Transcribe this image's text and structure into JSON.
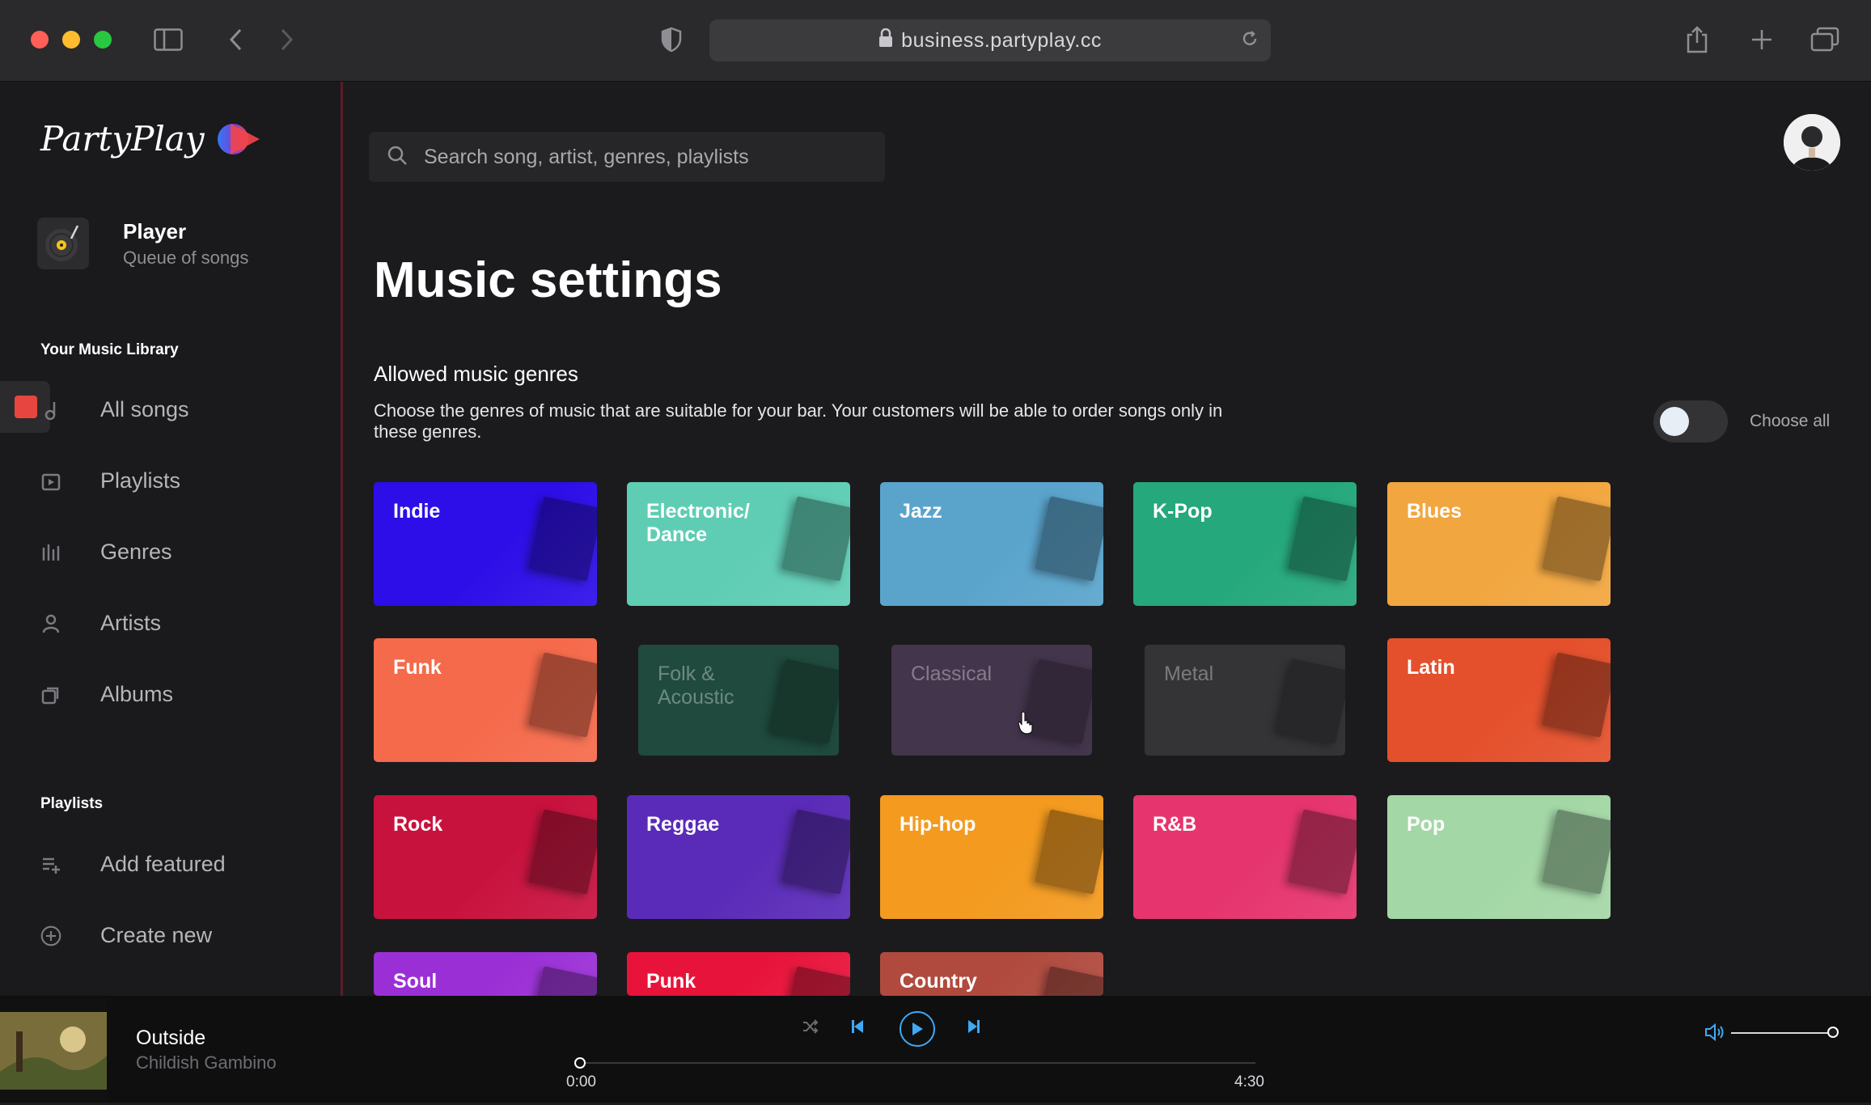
{
  "browser": {
    "url": "business.partyplay.cc"
  },
  "brand": {
    "logo_text": "PartyPlay",
    "accent": "#e6463f"
  },
  "sidebar": {
    "player": {
      "title": "Player",
      "subtitle": "Queue of songs"
    },
    "library_label": "Your Music Library",
    "library_items": [
      {
        "label": "All songs",
        "icon": "music-note-icon"
      },
      {
        "label": "Playlists",
        "icon": "playlist-icon"
      },
      {
        "label": "Genres",
        "icon": "equalizer-icon"
      },
      {
        "label": "Artists",
        "icon": "person-icon"
      },
      {
        "label": "Albums",
        "icon": "album-icon"
      }
    ],
    "playlists_label": "Playlists",
    "playlist_items": [
      {
        "label": "Add featured",
        "icon": "add-list-icon"
      },
      {
        "label": "Create new",
        "icon": "plus-circle-icon"
      }
    ]
  },
  "search": {
    "placeholder": "Search song, artist, genres, playlists"
  },
  "main": {
    "title": "Music settings",
    "section_title": "Allowed music genres",
    "description": "Choose the genres of music that are suitable for your bar. Your customers will be able to order songs only in these genres.",
    "choose_all_label": "Choose all",
    "choose_all_enabled": false
  },
  "genres": [
    {
      "label": "Indie",
      "enabled": true,
      "color": "#2d0ee8"
    },
    {
      "label": "Electronic/ Dance",
      "enabled": true,
      "color": "#5fcdb4"
    },
    {
      "label": "Jazz",
      "enabled": true,
      "color": "#5aa4cc"
    },
    {
      "label": "K-Pop",
      "enabled": true,
      "color": "#25a87c"
    },
    {
      "label": "Blues",
      "enabled": true,
      "color": "#f2a63f"
    },
    {
      "label": "Funk",
      "enabled": true,
      "color": "#f56a4b"
    },
    {
      "label": "Folk & Acoustic",
      "enabled": false,
      "color": "#1f4a3d"
    },
    {
      "label": "Classical",
      "enabled": false,
      "color": "#43354c"
    },
    {
      "label": "Metal",
      "enabled": false,
      "color": "#343437"
    },
    {
      "label": "Latin",
      "enabled": true,
      "color": "#e4502c"
    },
    {
      "label": "Rock",
      "enabled": true,
      "color": "#c8123e"
    },
    {
      "label": "Reggae",
      "enabled": true,
      "color": "#5a2bb8"
    },
    {
      "label": "Hip-hop",
      "enabled": true,
      "color": "#f39a1f"
    },
    {
      "label": "R&B",
      "enabled": true,
      "color": "#e6356e"
    },
    {
      "label": "Pop",
      "enabled": true,
      "color": "#a4d7a6"
    },
    {
      "label": "Soul",
      "enabled": true,
      "color": "#9b2fd6"
    },
    {
      "label": "Punk",
      "enabled": true,
      "color": "#e8133a"
    },
    {
      "label": "Country",
      "enabled": true,
      "color": "#b04a3e"
    }
  ],
  "now_playing": {
    "title": "Outside",
    "artist": "Childish Gambino",
    "elapsed": "0:00",
    "duration": "4:30",
    "progress": 0,
    "volume": 1.0,
    "accent": "#3fa9f5"
  }
}
